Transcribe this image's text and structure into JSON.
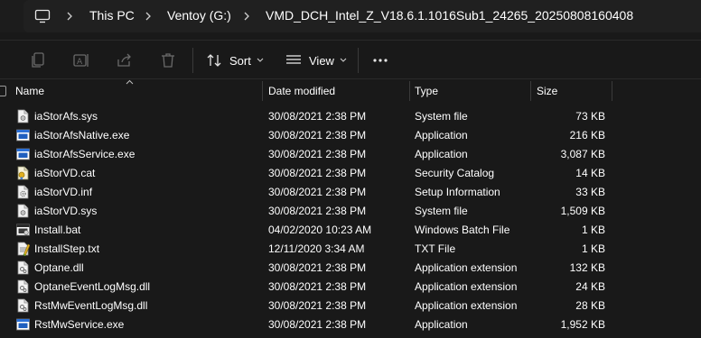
{
  "address": {
    "crumbs": [
      "This PC",
      "Ventoy (G:)",
      "VMD_DCH_Intel_Z_V18.6.1.1016Sub1_24265_20250808160408"
    ]
  },
  "toolbar": {
    "sort_label": "Sort",
    "view_label": "View",
    "more_label": "···"
  },
  "columns": {
    "name": "Name",
    "date": "Date modified",
    "type": "Type",
    "size": "Size"
  },
  "files": [
    {
      "name": "iaStorAfs.sys",
      "date": "30/08/2021 2:38 PM",
      "type": "System file",
      "size": "73 KB",
      "icon": "sys"
    },
    {
      "name": "iaStorAfsNative.exe",
      "date": "30/08/2021 2:38 PM",
      "type": "Application",
      "size": "216 KB",
      "icon": "exe"
    },
    {
      "name": "iaStorAfsService.exe",
      "date": "30/08/2021 2:38 PM",
      "type": "Application",
      "size": "3,087 KB",
      "icon": "exe"
    },
    {
      "name": "iaStorVD.cat",
      "date": "30/08/2021 2:38 PM",
      "type": "Security Catalog",
      "size": "14 KB",
      "icon": "cat"
    },
    {
      "name": "iaStorVD.inf",
      "date": "30/08/2021 2:38 PM",
      "type": "Setup Information",
      "size": "33 KB",
      "icon": "inf"
    },
    {
      "name": "iaStorVD.sys",
      "date": "30/08/2021 2:38 PM",
      "type": "System file",
      "size": "1,509 KB",
      "icon": "sys"
    },
    {
      "name": "Install.bat",
      "date": "04/02/2020 10:23 AM",
      "type": "Windows Batch File",
      "size": "1 KB",
      "icon": "bat"
    },
    {
      "name": "InstallStep.txt",
      "date": "12/11/2020 3:34 AM",
      "type": "TXT File",
      "size": "1 KB",
      "icon": "txt"
    },
    {
      "name": "Optane.dll",
      "date": "30/08/2021 2:38 PM",
      "type": "Application extension",
      "size": "132 KB",
      "icon": "dll"
    },
    {
      "name": "OptaneEventLogMsg.dll",
      "date": "30/08/2021 2:38 PM",
      "type": "Application extension",
      "size": "24 KB",
      "icon": "dll"
    },
    {
      "name": "RstMwEventLogMsg.dll",
      "date": "30/08/2021 2:38 PM",
      "type": "Application extension",
      "size": "28 KB",
      "icon": "dll"
    },
    {
      "name": "RstMwService.exe",
      "date": "30/08/2021 2:38 PM",
      "type": "Application",
      "size": "1,952 KB",
      "icon": "exe"
    }
  ]
}
